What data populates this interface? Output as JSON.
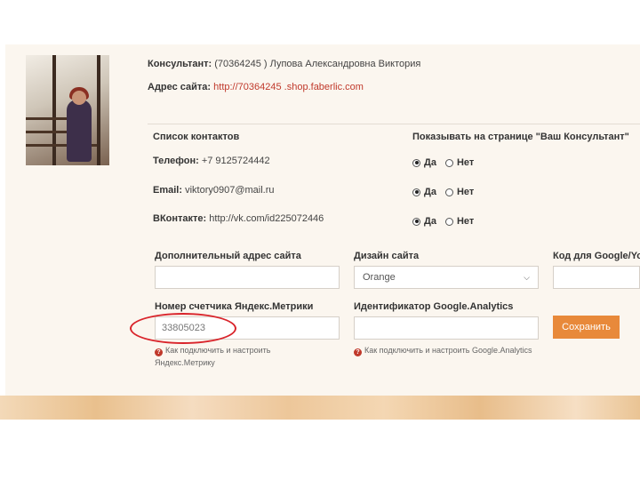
{
  "consultant": {
    "label": "Консультант:",
    "value": "(70364245 ) Лупова Александровна Виктория"
  },
  "site": {
    "label": "Адрес сайта:",
    "url": "http://70364245 .shop.faberlic.com"
  },
  "contacts": {
    "title": "Список контактов",
    "show_title": "Показывать на странице \"Ваш Консультант\"",
    "rows": [
      {
        "label": "Телефон:",
        "value": "+7 9125724442",
        "yes": "Да",
        "no": "Нет",
        "selected": "yes"
      },
      {
        "label": "Email:",
        "value": "viktory0907@mail.ru",
        "yes": "Да",
        "no": "Нет",
        "selected": "yes"
      },
      {
        "label": "ВКонтакте:",
        "value": "http://vk.com/id225072446",
        "yes": "Да",
        "no": "Нет",
        "selected": "yes"
      }
    ]
  },
  "fields": {
    "extra_site_label": "Дополнительный адрес сайта",
    "extra_site_value": "",
    "design_label": "Дизайн сайта",
    "design_value": "Orange",
    "google_code_label": "Код для Google/Yo",
    "google_code_value": "",
    "yandex_label": "Номер счетчика Яндекс.Метрики",
    "yandex_value": "33805023",
    "ga_label": "Идентификатор Google.Analytics",
    "ga_value": ""
  },
  "save_button": "Сохранить",
  "help": {
    "yandex_line1": "Как подключить и настроить",
    "yandex_line2": "Яндекс.Метрику",
    "ga": "Как подключить и настроить Google.Analytics",
    "q_icon": "?"
  },
  "colors": {
    "accent": "#e8893a",
    "link": "#c0392b",
    "highlight_circle": "#d9242b"
  }
}
